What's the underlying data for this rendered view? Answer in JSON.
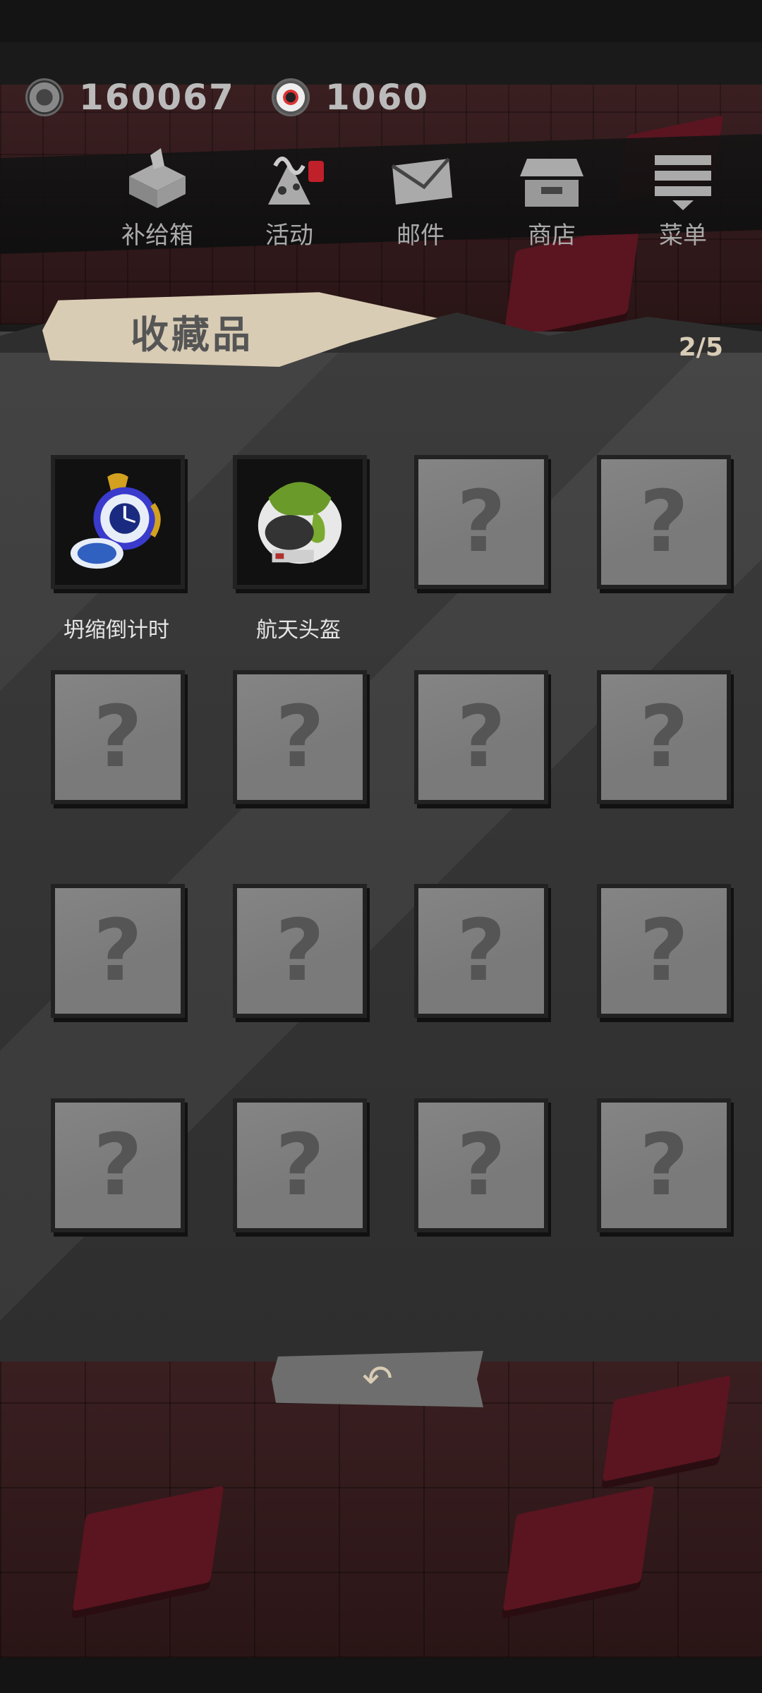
{
  "currency": {
    "coins": "160067",
    "gems": "1060"
  },
  "menu": [
    {
      "label": "补给箱",
      "icon": "supply-box-icon"
    },
    {
      "label": "活动",
      "icon": "event-icon",
      "notification": true
    },
    {
      "label": "邮件",
      "icon": "mail-icon"
    },
    {
      "label": "商店",
      "icon": "shop-icon"
    },
    {
      "label": "菜单",
      "icon": "menu-icon"
    }
  ],
  "collection": {
    "title": "收藏品",
    "progress": "2/5",
    "items": [
      {
        "name": "坍缩倒计时",
        "unlocked": true,
        "icon": "pocket-watch-icon"
      },
      {
        "name": "航天头盔",
        "unlocked": true,
        "icon": "space-helmet-icon"
      },
      {
        "name": "",
        "unlocked": false
      },
      {
        "name": "",
        "unlocked": false
      },
      {
        "name": "",
        "unlocked": false
      },
      {
        "name": "",
        "unlocked": false
      },
      {
        "name": "",
        "unlocked": false
      },
      {
        "name": "",
        "unlocked": false
      },
      {
        "name": "",
        "unlocked": false
      },
      {
        "name": "",
        "unlocked": false
      },
      {
        "name": "",
        "unlocked": false
      },
      {
        "name": "",
        "unlocked": false
      },
      {
        "name": "",
        "unlocked": false
      },
      {
        "name": "",
        "unlocked": false
      },
      {
        "name": "",
        "unlocked": false
      },
      {
        "name": "",
        "unlocked": false
      }
    ],
    "locked_glyph": "?"
  },
  "back_button": {
    "glyph": "↶",
    "icon": "back-arrow-icon"
  }
}
